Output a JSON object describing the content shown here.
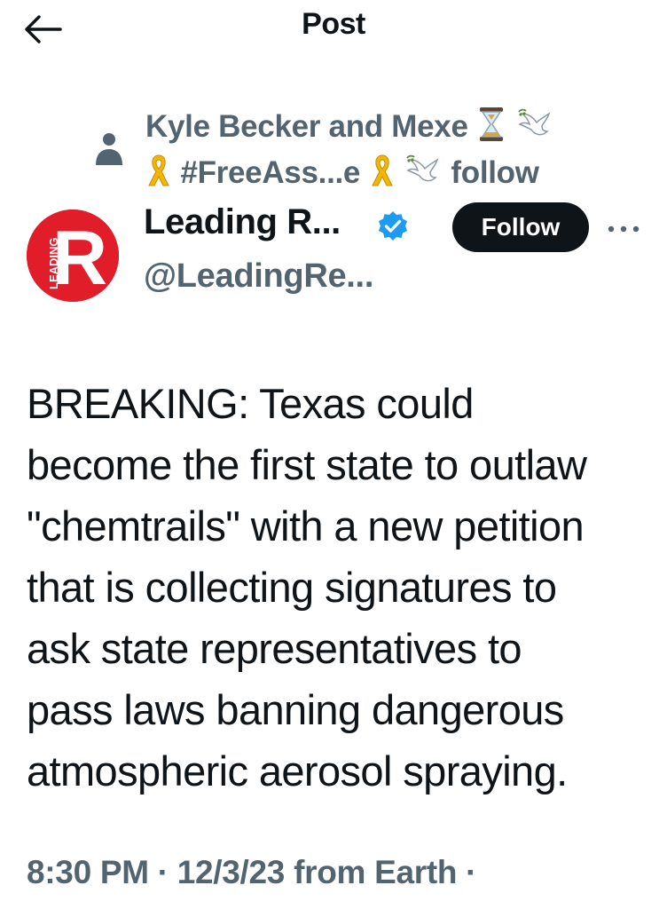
{
  "header": {
    "title": "Post"
  },
  "social_context": {
    "line1_text": "Kyle Becker and Mexe",
    "line2_hashtag": "#FreeAss...e",
    "line2_follow": "follow",
    "icons": [
      "person-icon",
      "hourglass-icon",
      "dove-icon",
      "yellow-ribbon-icon"
    ]
  },
  "author": {
    "display_name": "Leading R...",
    "handle": "@LeadingRe...",
    "avatar_text": "LEADING",
    "avatar_letter": "R",
    "verified": true,
    "follow_label": "Follow"
  },
  "post": {
    "lines": [
      "BREAKING: Texas could",
      "become the first state to outlaw",
      "\"chemtrails\" with a new petition",
      "that is collecting signatures to",
      "ask state representatives to",
      "pass laws banning dangerous",
      "atmospheric aerosol spraying."
    ]
  },
  "meta": {
    "time": "8:30 PM",
    "date": "12/3/23",
    "source": "from Earth",
    "separator": "·"
  },
  "colors": {
    "text": "#0f1419",
    "secondary": "#536471",
    "avatar_red": "#e11d2a",
    "verified_blue": "#1d9bf0",
    "follow_button": "#0f1419"
  }
}
